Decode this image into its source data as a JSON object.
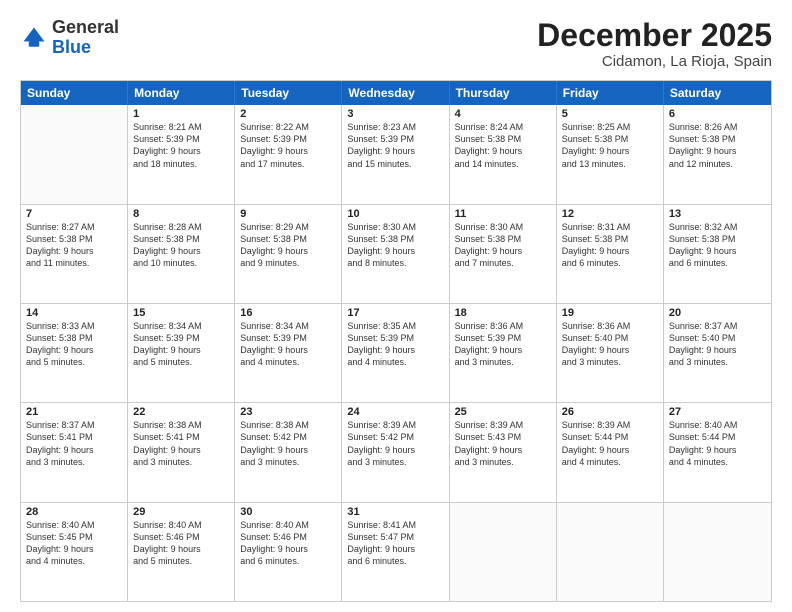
{
  "logo": {
    "general": "General",
    "blue": "Blue"
  },
  "title": "December 2025",
  "subtitle": "Cidamon, La Rioja, Spain",
  "header_days": [
    "Sunday",
    "Monday",
    "Tuesday",
    "Wednesday",
    "Thursday",
    "Friday",
    "Saturday"
  ],
  "weeks": [
    [
      {
        "day": "",
        "lines": []
      },
      {
        "day": "1",
        "lines": [
          "Sunrise: 8:21 AM",
          "Sunset: 5:39 PM",
          "Daylight: 9 hours",
          "and 18 minutes."
        ]
      },
      {
        "day": "2",
        "lines": [
          "Sunrise: 8:22 AM",
          "Sunset: 5:39 PM",
          "Daylight: 9 hours",
          "and 17 minutes."
        ]
      },
      {
        "day": "3",
        "lines": [
          "Sunrise: 8:23 AM",
          "Sunset: 5:39 PM",
          "Daylight: 9 hours",
          "and 15 minutes."
        ]
      },
      {
        "day": "4",
        "lines": [
          "Sunrise: 8:24 AM",
          "Sunset: 5:38 PM",
          "Daylight: 9 hours",
          "and 14 minutes."
        ]
      },
      {
        "day": "5",
        "lines": [
          "Sunrise: 8:25 AM",
          "Sunset: 5:38 PM",
          "Daylight: 9 hours",
          "and 13 minutes."
        ]
      },
      {
        "day": "6",
        "lines": [
          "Sunrise: 8:26 AM",
          "Sunset: 5:38 PM",
          "Daylight: 9 hours",
          "and 12 minutes."
        ]
      }
    ],
    [
      {
        "day": "7",
        "lines": [
          "Sunrise: 8:27 AM",
          "Sunset: 5:38 PM",
          "Daylight: 9 hours",
          "and 11 minutes."
        ]
      },
      {
        "day": "8",
        "lines": [
          "Sunrise: 8:28 AM",
          "Sunset: 5:38 PM",
          "Daylight: 9 hours",
          "and 10 minutes."
        ]
      },
      {
        "day": "9",
        "lines": [
          "Sunrise: 8:29 AM",
          "Sunset: 5:38 PM",
          "Daylight: 9 hours",
          "and 9 minutes."
        ]
      },
      {
        "day": "10",
        "lines": [
          "Sunrise: 8:30 AM",
          "Sunset: 5:38 PM",
          "Daylight: 9 hours",
          "and 8 minutes."
        ]
      },
      {
        "day": "11",
        "lines": [
          "Sunrise: 8:30 AM",
          "Sunset: 5:38 PM",
          "Daylight: 9 hours",
          "and 7 minutes."
        ]
      },
      {
        "day": "12",
        "lines": [
          "Sunrise: 8:31 AM",
          "Sunset: 5:38 PM",
          "Daylight: 9 hours",
          "and 6 minutes."
        ]
      },
      {
        "day": "13",
        "lines": [
          "Sunrise: 8:32 AM",
          "Sunset: 5:38 PM",
          "Daylight: 9 hours",
          "and 6 minutes."
        ]
      }
    ],
    [
      {
        "day": "14",
        "lines": [
          "Sunrise: 8:33 AM",
          "Sunset: 5:38 PM",
          "Daylight: 9 hours",
          "and 5 minutes."
        ]
      },
      {
        "day": "15",
        "lines": [
          "Sunrise: 8:34 AM",
          "Sunset: 5:39 PM",
          "Daylight: 9 hours",
          "and 5 minutes."
        ]
      },
      {
        "day": "16",
        "lines": [
          "Sunrise: 8:34 AM",
          "Sunset: 5:39 PM",
          "Daylight: 9 hours",
          "and 4 minutes."
        ]
      },
      {
        "day": "17",
        "lines": [
          "Sunrise: 8:35 AM",
          "Sunset: 5:39 PM",
          "Daylight: 9 hours",
          "and 4 minutes."
        ]
      },
      {
        "day": "18",
        "lines": [
          "Sunrise: 8:36 AM",
          "Sunset: 5:39 PM",
          "Daylight: 9 hours",
          "and 3 minutes."
        ]
      },
      {
        "day": "19",
        "lines": [
          "Sunrise: 8:36 AM",
          "Sunset: 5:40 PM",
          "Daylight: 9 hours",
          "and 3 minutes."
        ]
      },
      {
        "day": "20",
        "lines": [
          "Sunrise: 8:37 AM",
          "Sunset: 5:40 PM",
          "Daylight: 9 hours",
          "and 3 minutes."
        ]
      }
    ],
    [
      {
        "day": "21",
        "lines": [
          "Sunrise: 8:37 AM",
          "Sunset: 5:41 PM",
          "Daylight: 9 hours",
          "and 3 minutes."
        ]
      },
      {
        "day": "22",
        "lines": [
          "Sunrise: 8:38 AM",
          "Sunset: 5:41 PM",
          "Daylight: 9 hours",
          "and 3 minutes."
        ]
      },
      {
        "day": "23",
        "lines": [
          "Sunrise: 8:38 AM",
          "Sunset: 5:42 PM",
          "Daylight: 9 hours",
          "and 3 minutes."
        ]
      },
      {
        "day": "24",
        "lines": [
          "Sunrise: 8:39 AM",
          "Sunset: 5:42 PM",
          "Daylight: 9 hours",
          "and 3 minutes."
        ]
      },
      {
        "day": "25",
        "lines": [
          "Sunrise: 8:39 AM",
          "Sunset: 5:43 PM",
          "Daylight: 9 hours",
          "and 3 minutes."
        ]
      },
      {
        "day": "26",
        "lines": [
          "Sunrise: 8:39 AM",
          "Sunset: 5:44 PM",
          "Daylight: 9 hours",
          "and 4 minutes."
        ]
      },
      {
        "day": "27",
        "lines": [
          "Sunrise: 8:40 AM",
          "Sunset: 5:44 PM",
          "Daylight: 9 hours",
          "and 4 minutes."
        ]
      }
    ],
    [
      {
        "day": "28",
        "lines": [
          "Sunrise: 8:40 AM",
          "Sunset: 5:45 PM",
          "Daylight: 9 hours",
          "and 4 minutes."
        ]
      },
      {
        "day": "29",
        "lines": [
          "Sunrise: 8:40 AM",
          "Sunset: 5:46 PM",
          "Daylight: 9 hours",
          "and 5 minutes."
        ]
      },
      {
        "day": "30",
        "lines": [
          "Sunrise: 8:40 AM",
          "Sunset: 5:46 PM",
          "Daylight: 9 hours",
          "and 6 minutes."
        ]
      },
      {
        "day": "31",
        "lines": [
          "Sunrise: 8:41 AM",
          "Sunset: 5:47 PM",
          "Daylight: 9 hours",
          "and 6 minutes."
        ]
      },
      {
        "day": "",
        "lines": []
      },
      {
        "day": "",
        "lines": []
      },
      {
        "day": "",
        "lines": []
      }
    ]
  ]
}
